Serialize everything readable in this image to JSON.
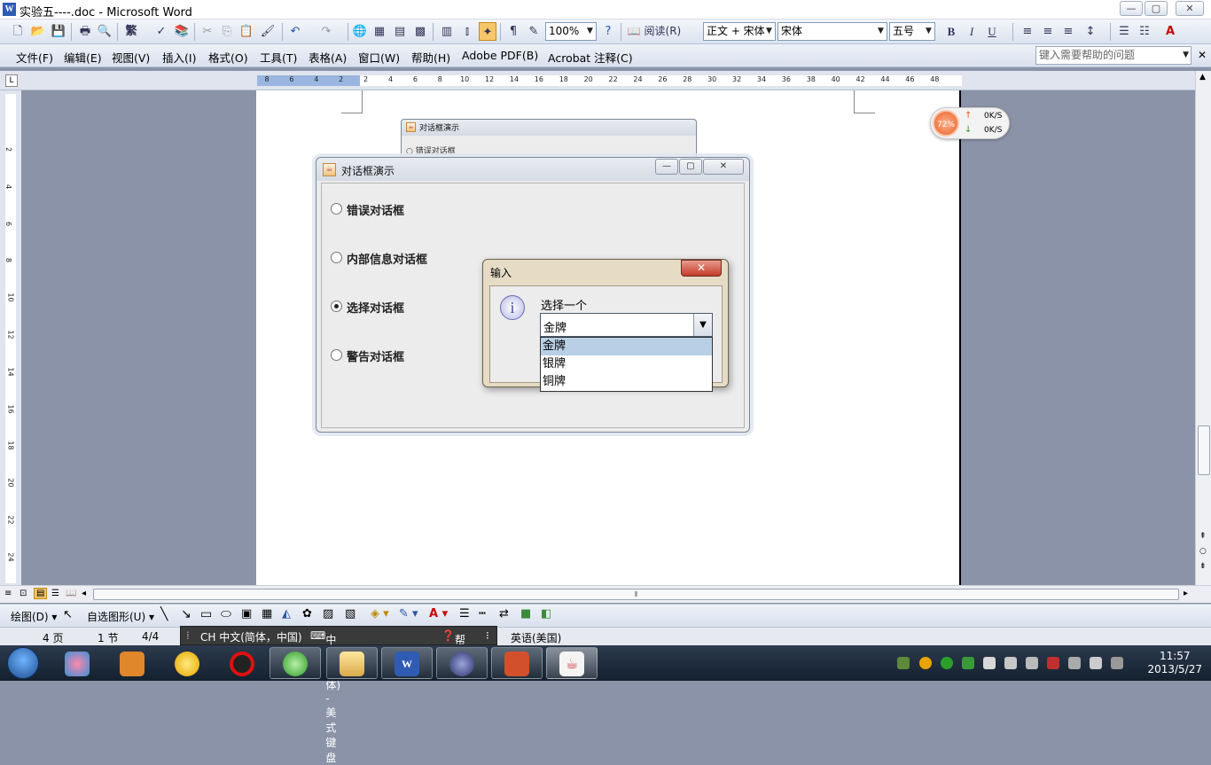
{
  "window": {
    "title": "实验五----.doc - Microsoft Word",
    "icon_letter": "W",
    "minimize": "—",
    "maximize": "▢",
    "close": "✕"
  },
  "toolbar": {
    "traditional_chinese": "繁",
    "zoom": "100%",
    "read_label": "阅读(R)",
    "style": "正文 + 宋体",
    "font": "宋体",
    "font_size": "五号",
    "bold": "B",
    "italic": "I",
    "underline": "U",
    "font_color_letter": "A"
  },
  "menu": {
    "items": [
      "文件(F)",
      "编辑(E)",
      "视图(V)",
      "插入(I)",
      "格式(O)",
      "工具(T)",
      "表格(A)",
      "窗口(W)",
      "帮助(H)",
      "Adobe PDF(B)",
      "Acrobat 注释(C)"
    ],
    "help_placeholder": "键入需要帮助的问题"
  },
  "ruler": {
    "numbers": [
      "8",
      "6",
      "4",
      "2",
      "2",
      "4",
      "6",
      "8",
      "10",
      "12",
      "14",
      "16",
      "18",
      "20",
      "22",
      "24",
      "26",
      "28",
      "30",
      "32",
      "34",
      "36",
      "38",
      "40",
      "42",
      "44",
      "46",
      "48"
    ],
    "vertical": [
      "2",
      "4",
      "6",
      "8",
      "10",
      "12",
      "14",
      "16",
      "18",
      "20",
      "22",
      "24"
    ]
  },
  "netmon": {
    "percent": "72%",
    "up": "0K/S",
    "down": "0K/S",
    "up_arrow": "↑",
    "down_arrow": "↓"
  },
  "back_dialog": {
    "title": "对话框演示",
    "option": "错误对话框"
  },
  "main_dialog": {
    "title": "对话框演示",
    "options": [
      {
        "label": "错误对话框",
        "selected": false
      },
      {
        "label": "内部信息对话框",
        "selected": false
      },
      {
        "label": "选择对话框",
        "selected": true
      },
      {
        "label": "警告对话框",
        "selected": false
      }
    ]
  },
  "input_dialog": {
    "title": "输入",
    "close": "✕",
    "info_glyph": "i",
    "prompt": "选择一个",
    "selected_value": "金牌",
    "options": [
      "金牌",
      "银牌",
      "铜牌"
    ],
    "highlighted_option": "金牌"
  },
  "drawbar": {
    "draw": "绘图(D)",
    "autoshapes": "自选图形(U)"
  },
  "statusbar": {
    "page": "4 页",
    "section": "1 节",
    "page_count": "4/4",
    "language": "英语(美国)"
  },
  "ime": {
    "mode": "CH 中文(简体，中国)",
    "keyboard": "中文(简体) - 美式键盘",
    "help": "帮助"
  },
  "clock": {
    "time": "11:57",
    "date": "2013/5/27"
  }
}
